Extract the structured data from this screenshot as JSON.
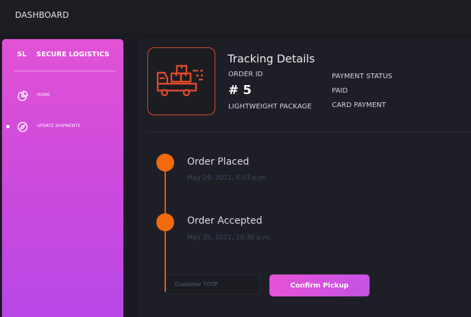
{
  "header": {
    "title": "DASHBOARD"
  },
  "sidebar": {
    "brand_short": "SL",
    "brand_name": "SECURE LOGISTICS",
    "items": [
      {
        "label": "HOME",
        "icon": "pie-chart-icon",
        "active": false
      },
      {
        "label": "UPDATE SHIPMENTS",
        "icon": "compass-icon",
        "active": true
      }
    ]
  },
  "tracking": {
    "title": "Tracking Details",
    "order_id_label": "ORDER ID",
    "order_number": "# 5",
    "package_type": "LIGHTWEIGHT PACKAGE",
    "payment_status_label": "PAYMENT STATUS",
    "payment_status": "PAID",
    "payment_method": "CARD PAYMENT",
    "icon": "delivery-truck-icon"
  },
  "timeline": [
    {
      "title": "Order Placed",
      "date": "May 29, 2021, 5:03 p.m."
    },
    {
      "title": "Order Accepted",
      "date": "May 29, 2021, 10:36 p.m."
    }
  ],
  "pickup": {
    "totp_placeholder": "Customer TOTP",
    "totp_value": "",
    "confirm_label": "Confirm Pickup"
  },
  "colors": {
    "accent": "#e052d6",
    "timeline": "#f26a0c",
    "icon": "#e14b2b",
    "background": "#1a1b21"
  }
}
